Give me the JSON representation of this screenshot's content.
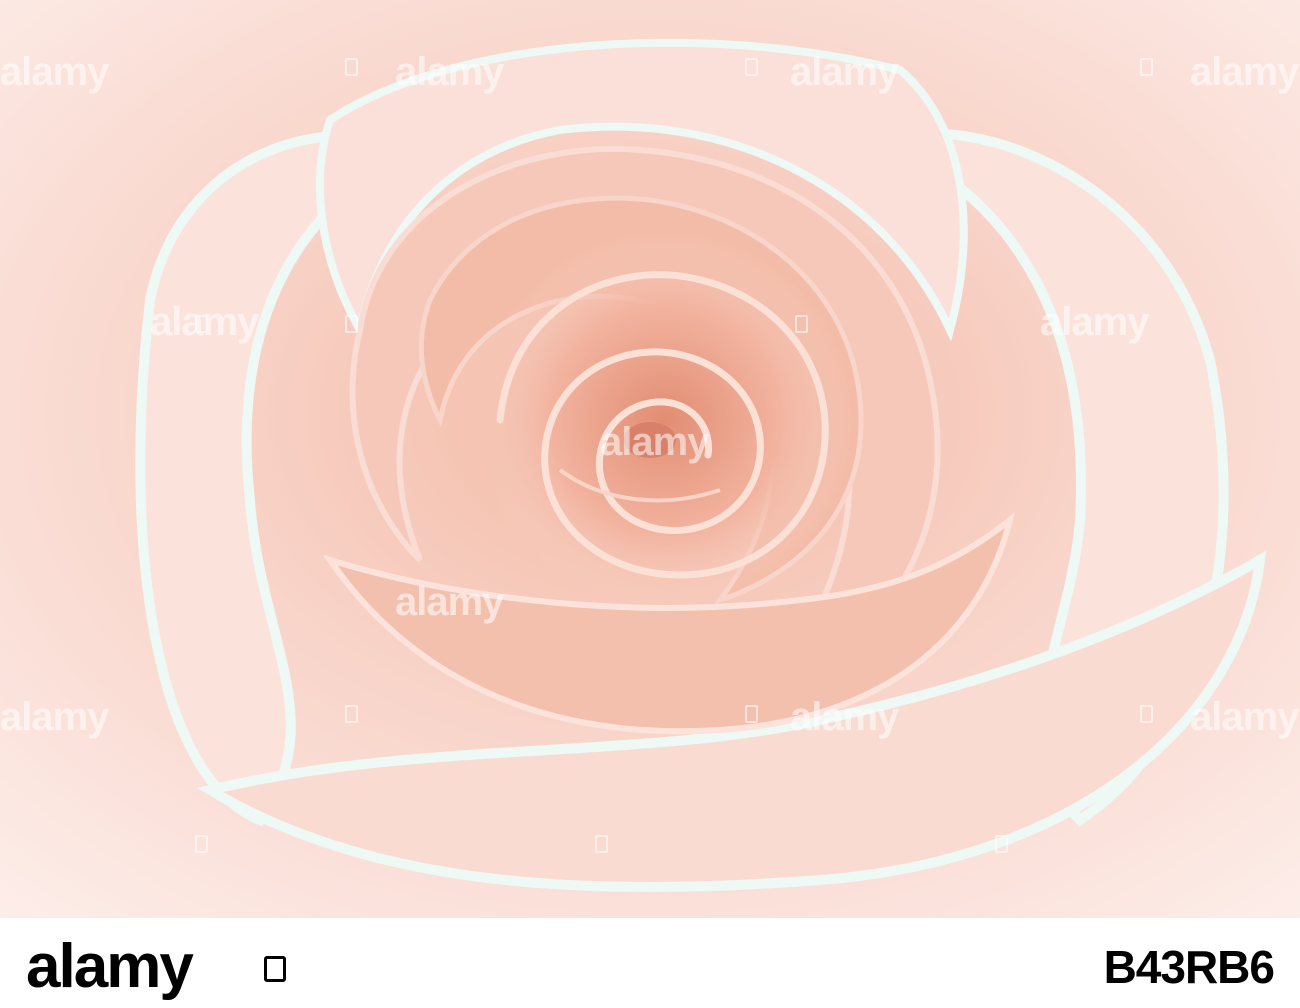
{
  "photo": {
    "subject": "rose-close-up",
    "colors": {
      "petal_light": "#fbe6e2",
      "petal_mid": "#f6c7b7",
      "petal_deep": "#e89a80",
      "highlight": "#eef8f4"
    }
  },
  "watermark": {
    "text": "alamy"
  },
  "footer": {
    "logo_text": "alamy",
    "image_id": "B43RB6"
  }
}
